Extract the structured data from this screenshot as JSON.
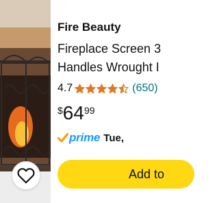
{
  "product": {
    "brand": "Fire Beauty",
    "title_lines": [
      "Fireplace Screen 3",
      "Handles Wrought I"
    ],
    "rating": "4.7",
    "stars_filled": 4.5,
    "review_count": "(650)",
    "price": {
      "symbol": "$",
      "whole": "64",
      "fraction": "99"
    },
    "prime_label": "prime",
    "delivery": "Tue,",
    "add_to_cart_label": "Add to"
  },
  "icons": {
    "wishlist": "heart-outline-icon",
    "prime_check": "prime-check-icon",
    "star": "star-icon"
  },
  "colors": {
    "star": "#de7921",
    "prime": "#1a98ff",
    "prime_check": "#ff9900",
    "add_to_cart_bg": "#ffd814",
    "review_link": "#007185"
  }
}
